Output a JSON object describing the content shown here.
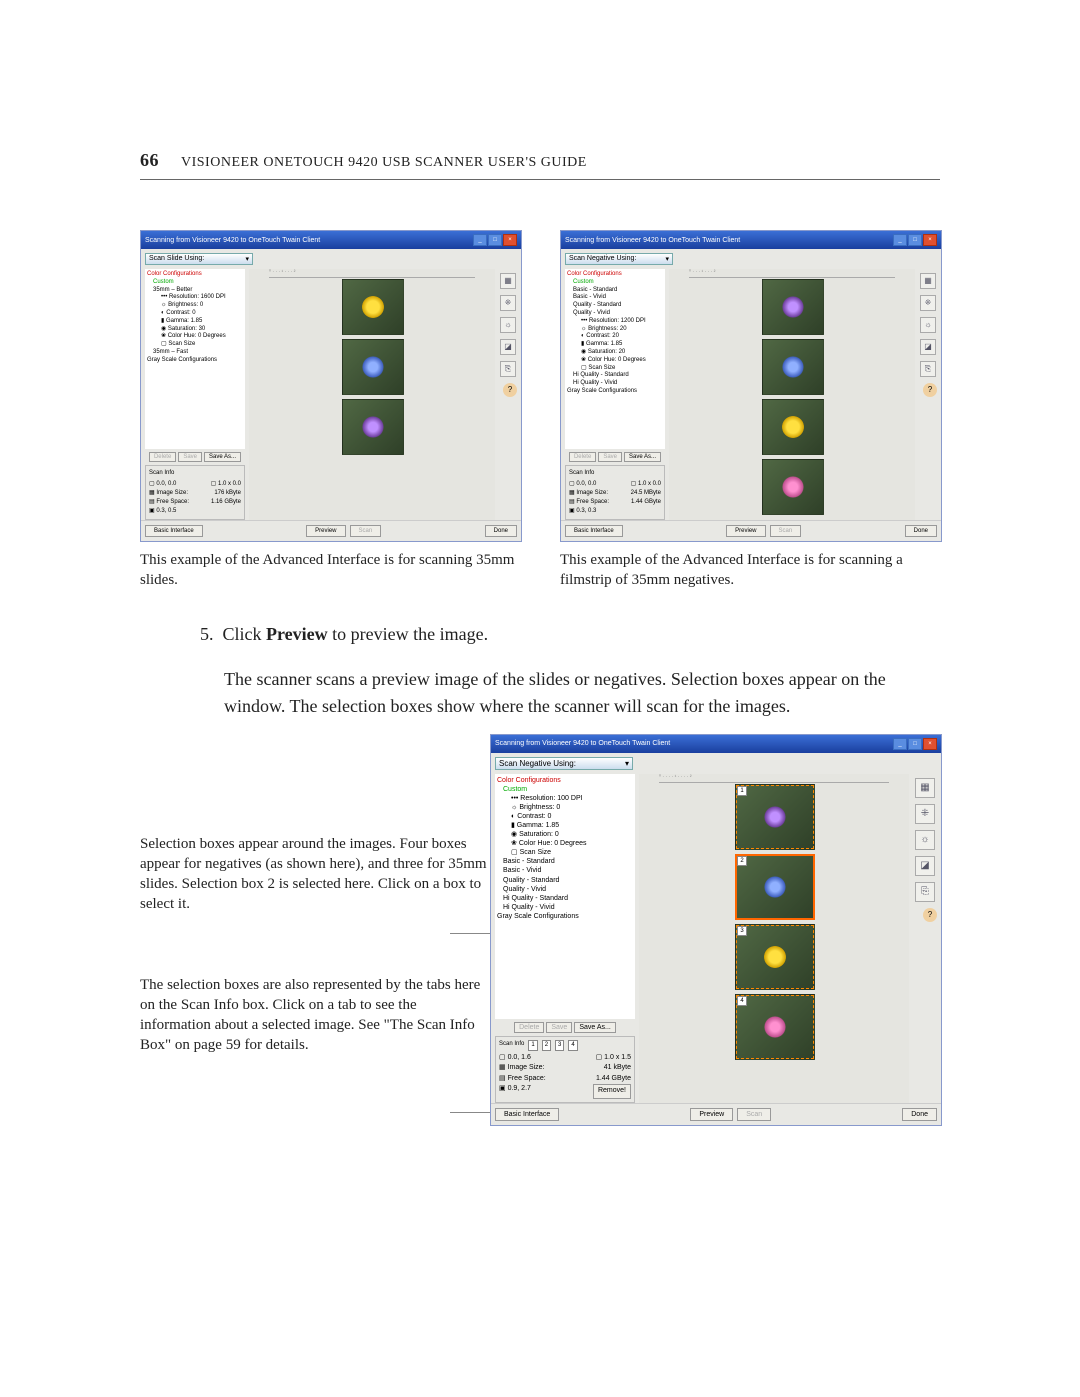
{
  "page_number": "66",
  "header_title": "VISIONEER ONETOUCH 9420 USB SCANNER USER'S GUIDE",
  "screenshot_common": {
    "window_title": "Scanning from Visioneer 9420 to OneTouch Twain Client",
    "basic_interface_btn": "Basic Interface",
    "preview_btn": "Preview",
    "scan_btn": "Scan",
    "done_btn": "Done",
    "delete_btn": "Delete",
    "save_btn": "Save",
    "saveas_btn": "Save As...",
    "scan_info_label": "Scan Info",
    "image_size_label": "Image Size:",
    "free_space_label": "Free Space:",
    "remove_btn": "Remove!",
    "tree_color_config": "Color Configurations",
    "tree_custom": "Custom",
    "tree_basic_std": "Basic - Standard",
    "tree_basic_vivid": "Basic - Vivid",
    "tree_quality_std": "Quality - Standard",
    "tree_quality_vivid": "Quality - Vivid",
    "tree_hi_quality_std": "Hi Quality - Standard",
    "tree_hi_quality_vivid": "Hi Quality - Vivid",
    "tree_gray": "Gray Scale Configurations",
    "tree_brightness": "Brightness: 0",
    "tree_contrast": "Contrast: 0",
    "tree_gamma": "Gamma: 1.85",
    "tree_saturation": "Saturation: 0",
    "tree_colorhue": "Color Hue: 0 Degrees",
    "tree_scansize": "Scan Size"
  },
  "left_ss": {
    "dropdown": "Scan Slide Using:",
    "tree_better": "35mm – Better",
    "tree_res": "Resolution: 1600 DPI",
    "tree_sat": "Saturation: 30",
    "tree_fast": "35mm – Fast",
    "dims1": "0.0, 0.0",
    "dims2": "1.0 x 0.0",
    "img_size": "176 kByte",
    "free_space": "1.16 GByte",
    "status": "0.3, 0.5"
  },
  "right_ss": {
    "dropdown": "Scan Negative Using:",
    "tree_res": "Resolution: 1200 DPI",
    "tree_bright": "Brightness: 20",
    "tree_contrast": "Contrast: 20",
    "tree_sat": "Saturation: 20",
    "dims1": "0.0, 0.0",
    "dims2": "1.0 x 0.0",
    "img_size": "24.5 MByte",
    "free_space": "1.44 GByte",
    "status": "0.3, 0.3"
  },
  "big_ss": {
    "dropdown": "Scan Negative Using:",
    "tree_res": "Resolution: 100 DPI",
    "dims1": "0.0, 1.6",
    "dims2": "1.0 x 1.5",
    "img_size": "41 kByte",
    "free_space": "1.44 GByte",
    "status": "0.9, 2.7",
    "tab1": "1",
    "tab2": "2",
    "tab3": "3",
    "tab4": "4"
  },
  "caption_left": "This example of the Advanced Interface is for scanning 35mm slides.",
  "caption_right": "This example of the Advanced Interface is for scanning a filmstrip of 35mm negatives.",
  "step5_num": "5.",
  "step5_a": "Click ",
  "step5_b": "Preview",
  "step5_c": " to preview the image.",
  "para1": "The scanner scans a preview image of the slides or negatives. Selection boxes appear on the window. The selection boxes show where the scanner will scan for the images.",
  "annot1": "Selection boxes appear around the images. Four boxes appear for negatives (as shown here), and three for 35mm slides. Selection box 2 is selected here. Click on a box to select it.",
  "annot2": "The selection boxes are also represented by the tabs here on the Scan Info box. Click on a tab to see the information about a selected image. See \"The Scan Info Box\" on page 59 for details."
}
